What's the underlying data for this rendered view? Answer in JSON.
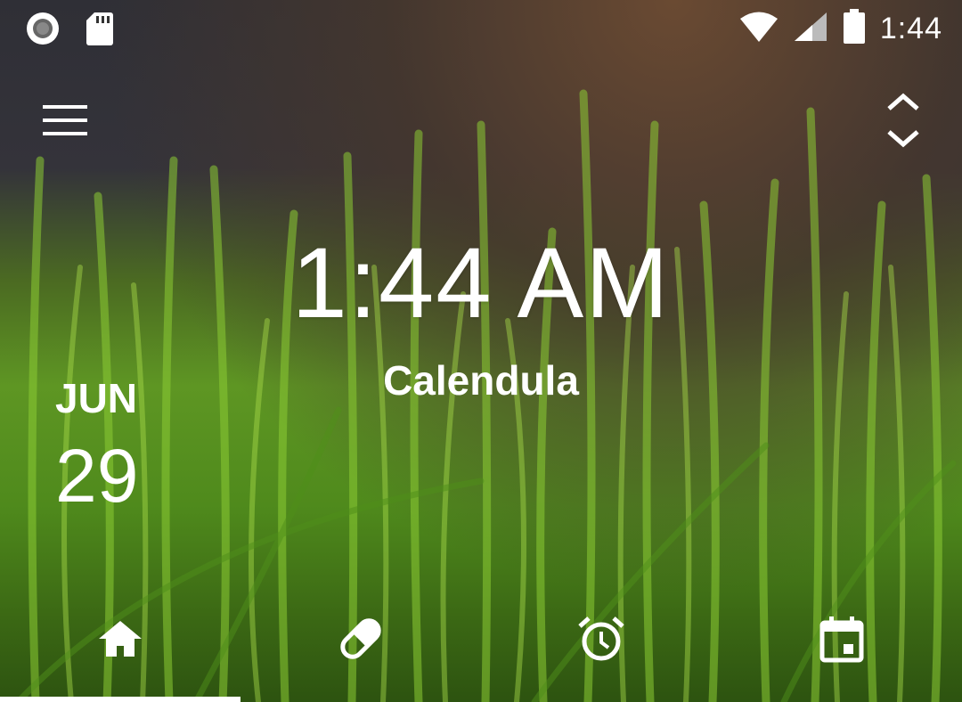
{
  "status_bar": {
    "time": "1:44",
    "icons": [
      "record-icon",
      "sd-card-icon",
      "wifi-icon",
      "cell-signal-icon",
      "battery-icon"
    ]
  },
  "toolbar": {
    "menu_icon": "hamburger-menu-icon",
    "expand_icon": "expand-collapse-icon"
  },
  "main": {
    "time": "1:44 AM",
    "app_name": "Calendula",
    "date": {
      "month": "JUN",
      "day": "29"
    }
  },
  "bottom_nav": {
    "items": [
      {
        "icon": "home-icon",
        "selected": true
      },
      {
        "icon": "pill-icon",
        "selected": false
      },
      {
        "icon": "alarm-clock-icon",
        "selected": false
      },
      {
        "icon": "calendar-icon",
        "selected": false
      }
    ]
  },
  "colors": {
    "foreground": "#ffffff",
    "grass_green": "#6ab22a",
    "dark_bg": "#2f2f36"
  }
}
